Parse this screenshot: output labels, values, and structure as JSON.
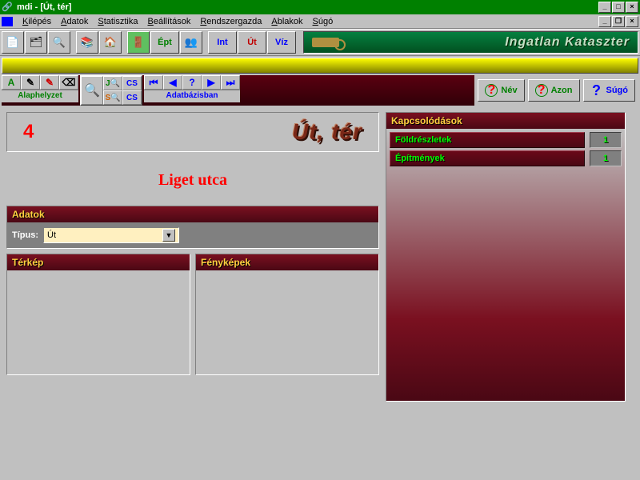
{
  "window": {
    "title": "mdi - [Út, tér]"
  },
  "menu": {
    "items": [
      "Kilépés",
      "Adatok",
      "Statisztika",
      "Beállítások",
      "Rendszergazda",
      "Ablakok",
      "Súgó"
    ]
  },
  "toolbar": {
    "brand": "Ingatlan Kataszter",
    "btns": {
      "ept": "Épt",
      "int": "Int",
      "ut": "Út",
      "viz": "Víz"
    }
  },
  "nav": {
    "alaphelyzet": "Alaphelyzet",
    "adatbazisban": "Adatbázisban",
    "nev": "Név",
    "azon": "Azon",
    "sugo": "Súgó"
  },
  "header": {
    "record_no": "4",
    "category": "Út, tér"
  },
  "street": {
    "name": "Liget utca"
  },
  "panels": {
    "adatok": "Adatok",
    "terkep": "Térkép",
    "fenykepek": "Fényképek",
    "kapcsolodasok": "Kapcsolódások"
  },
  "form": {
    "tipus_label": "Típus:",
    "tipus_value": "Út"
  },
  "relations": {
    "items": [
      {
        "label": "Földrészletek",
        "count": "1"
      },
      {
        "label": "Építmények",
        "count": "1"
      }
    ]
  }
}
